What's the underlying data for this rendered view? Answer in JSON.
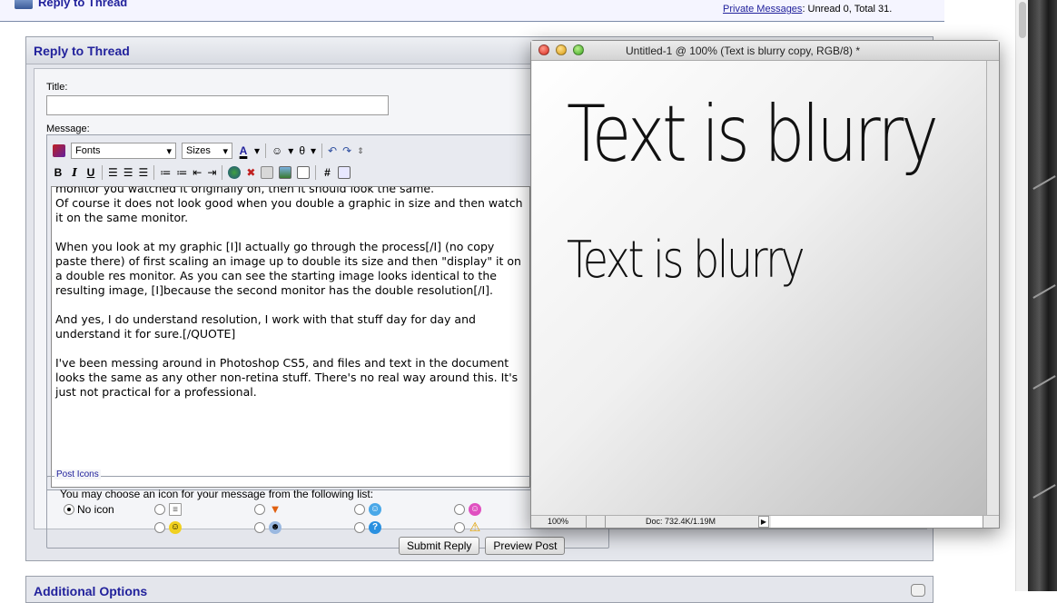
{
  "forum": {
    "top_title": "Reply to Thread",
    "pm_link": "Private Messages",
    "pm_status": ": Unread 0, Total 31."
  },
  "reply": {
    "header": "Reply to Thread",
    "title_label": "Title:",
    "title_value": "",
    "message_label": "Message:",
    "toolbar": {
      "font_label": "Fonts",
      "size_label": "Sizes",
      "bold": "B",
      "italic": "I",
      "underline": "U",
      "hash": "#"
    },
    "message_lines": [
      "monitor you watched it originally on, then it should look the same.\nOf course it does not look good when you double a graphic in size and then watch it on the same monitor.",
      "When you look at my graphic [I]I actually go through the process[/I] (no copy paste there) of first scaling an image up to double its size and then \"display\" it on a double res monitor. As you can see the starting image looks identical to the resulting image, [I]because the second monitor has the double resolution[/I].",
      "And yes, I do understand resolution, I work with that stuff day for day and understand it for sure.[/QUOTE]",
      "I've been messing around in Photoshop CS5, and files and text in the document looks the same as any other non-retina stuff. There's no real way around this. It's just not practical for a professional."
    ],
    "post_icons": {
      "legend": "Post Icons",
      "description": "You may choose an icon for your message from the following list:",
      "no_icon_label": "No icon"
    },
    "submit_label": "Submit Reply",
    "preview_label": "Preview Post"
  },
  "additional": {
    "header": "Additional Options"
  },
  "photoshop": {
    "window_title": "Untitled-1 @ 100% (Text is blurry copy, RGB/8) *",
    "big_text": "Text is blurry",
    "medium_text": "Text is blurry",
    "zoom": "100%",
    "doc_info": "Doc: 732.4K/1.19M"
  },
  "colors": {
    "link_blue": "#22229c",
    "panel_bg": "#e4e6ec"
  }
}
